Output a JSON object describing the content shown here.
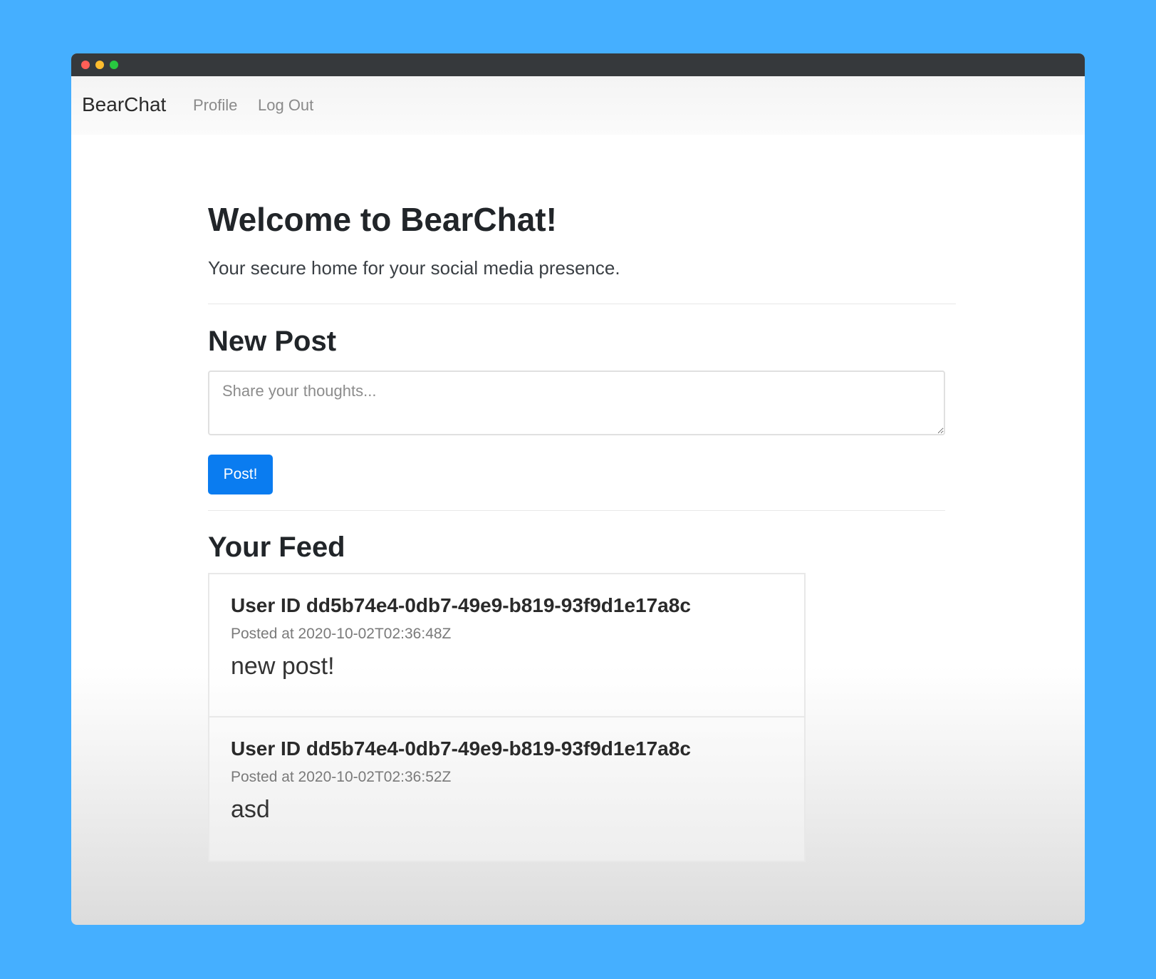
{
  "navbar": {
    "brand": "BearChat",
    "links": [
      "Profile",
      "Log Out"
    ]
  },
  "hero": {
    "title": "Welcome to BearChat!",
    "tagline": "Your secure home for your social media presence."
  },
  "new_post": {
    "heading": "New Post",
    "placeholder": "Share your thoughts...",
    "value": "",
    "button_label": "Post!"
  },
  "feed": {
    "heading": "Your Feed",
    "items": [
      {
        "user": "User ID dd5b74e4-0db7-49e9-b819-93f9d1e17a8c",
        "posted_at": "Posted at 2020-10-02T02:36:48Z",
        "body": "new post!"
      },
      {
        "user": "User ID dd5b74e4-0db7-49e9-b819-93f9d1e17a8c",
        "posted_at": "Posted at 2020-10-02T02:36:52Z",
        "body": "asd"
      }
    ]
  },
  "colors": {
    "background": "#45afff",
    "titlebar": "#36393c",
    "primary_button": "#0a7cf0",
    "traffic_red": "#ff5f57",
    "traffic_yellow": "#febc2e",
    "traffic_green": "#28c840"
  }
}
